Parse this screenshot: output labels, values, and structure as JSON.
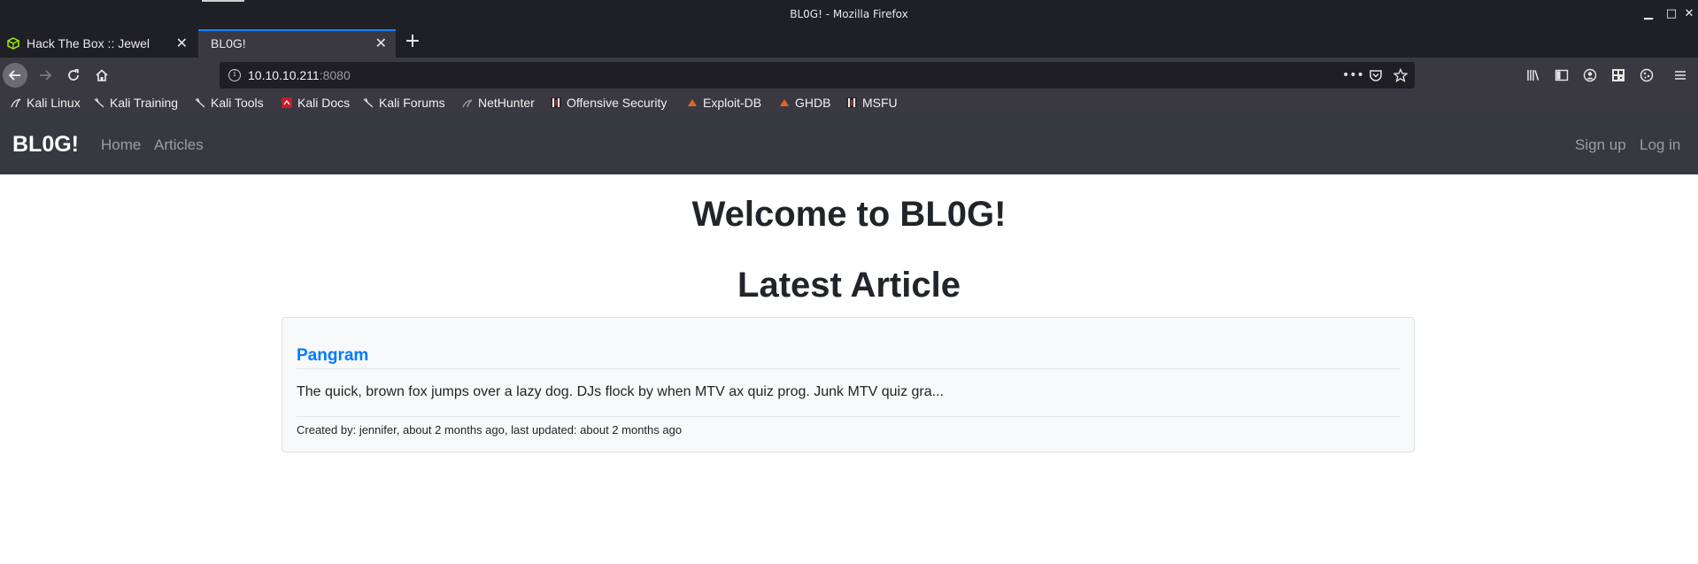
{
  "window": {
    "title": "BL0G! - Mozilla Firefox",
    "controls": {
      "minimize": "▁",
      "maximize": "□",
      "close": "✕"
    }
  },
  "tabs": [
    {
      "label": "Hack The Box :: Jewel",
      "icon": "hackthebox-cube-icon",
      "active": false
    },
    {
      "label": "BL0G!",
      "icon": "",
      "active": true
    }
  ],
  "navbar": {
    "url_host": "10.10.10.211",
    "url_port": ":8080",
    "accent": "#0a84ff"
  },
  "bookmarks": [
    {
      "label": "Kali Linux",
      "icon": "kali-dragon-icon"
    },
    {
      "label": "Kali Training",
      "icon": "kali-dragon-icon"
    },
    {
      "label": "Kali Tools",
      "icon": "kali-dragon-icon"
    },
    {
      "label": "Kali Docs",
      "icon": "kali-docs-icon"
    },
    {
      "label": "Kali Forums",
      "icon": "kali-dragon-icon"
    },
    {
      "label": "NetHunter",
      "icon": "nethunter-icon"
    },
    {
      "label": "Offensive Security",
      "icon": "offsec-icon"
    },
    {
      "label": "Exploit-DB",
      "icon": "exploitdb-icon"
    },
    {
      "label": "GHDB",
      "icon": "ghdb-icon"
    },
    {
      "label": "MSFU",
      "icon": "msfu-icon"
    }
  ],
  "site": {
    "brand": "BL0G!",
    "nav_left": [
      "Home",
      "Articles"
    ],
    "nav_right": [
      "Sign up",
      "Log in"
    ],
    "heading": "Welcome to BL0G!",
    "section_heading": "Latest Article",
    "article": {
      "title": "Pangram",
      "excerpt": "The quick, brown fox jumps over a lazy dog. DJs flock by when MTV ax quiz prog. Junk MTV quiz gra...",
      "meta": "Created by: jennifer, about 2 months ago, last updated: about 2 months ago"
    },
    "colors": {
      "navbar_bg": "#343a40",
      "link": "#007bff",
      "text": "#212529"
    }
  }
}
